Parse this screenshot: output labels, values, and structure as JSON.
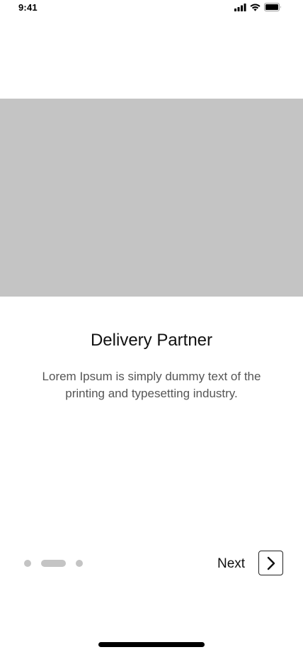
{
  "status_bar": {
    "time": "9:41"
  },
  "onboarding": {
    "title": "Delivery Partner",
    "description": "Lorem Ipsum is simply dummy text of the printing and typesetting industry.",
    "next_label": "Next",
    "pager": {
      "total": 3,
      "active_index": 1
    }
  },
  "icons": {
    "signal": "cellular-signal-icon",
    "wifi": "wifi-icon",
    "battery": "battery-icon",
    "next": "chevron-right-icon"
  },
  "colors": {
    "placeholder": "#c4c4c4",
    "dot": "#c4c4c4",
    "text_primary": "#111111",
    "text_secondary": "#555555"
  }
}
